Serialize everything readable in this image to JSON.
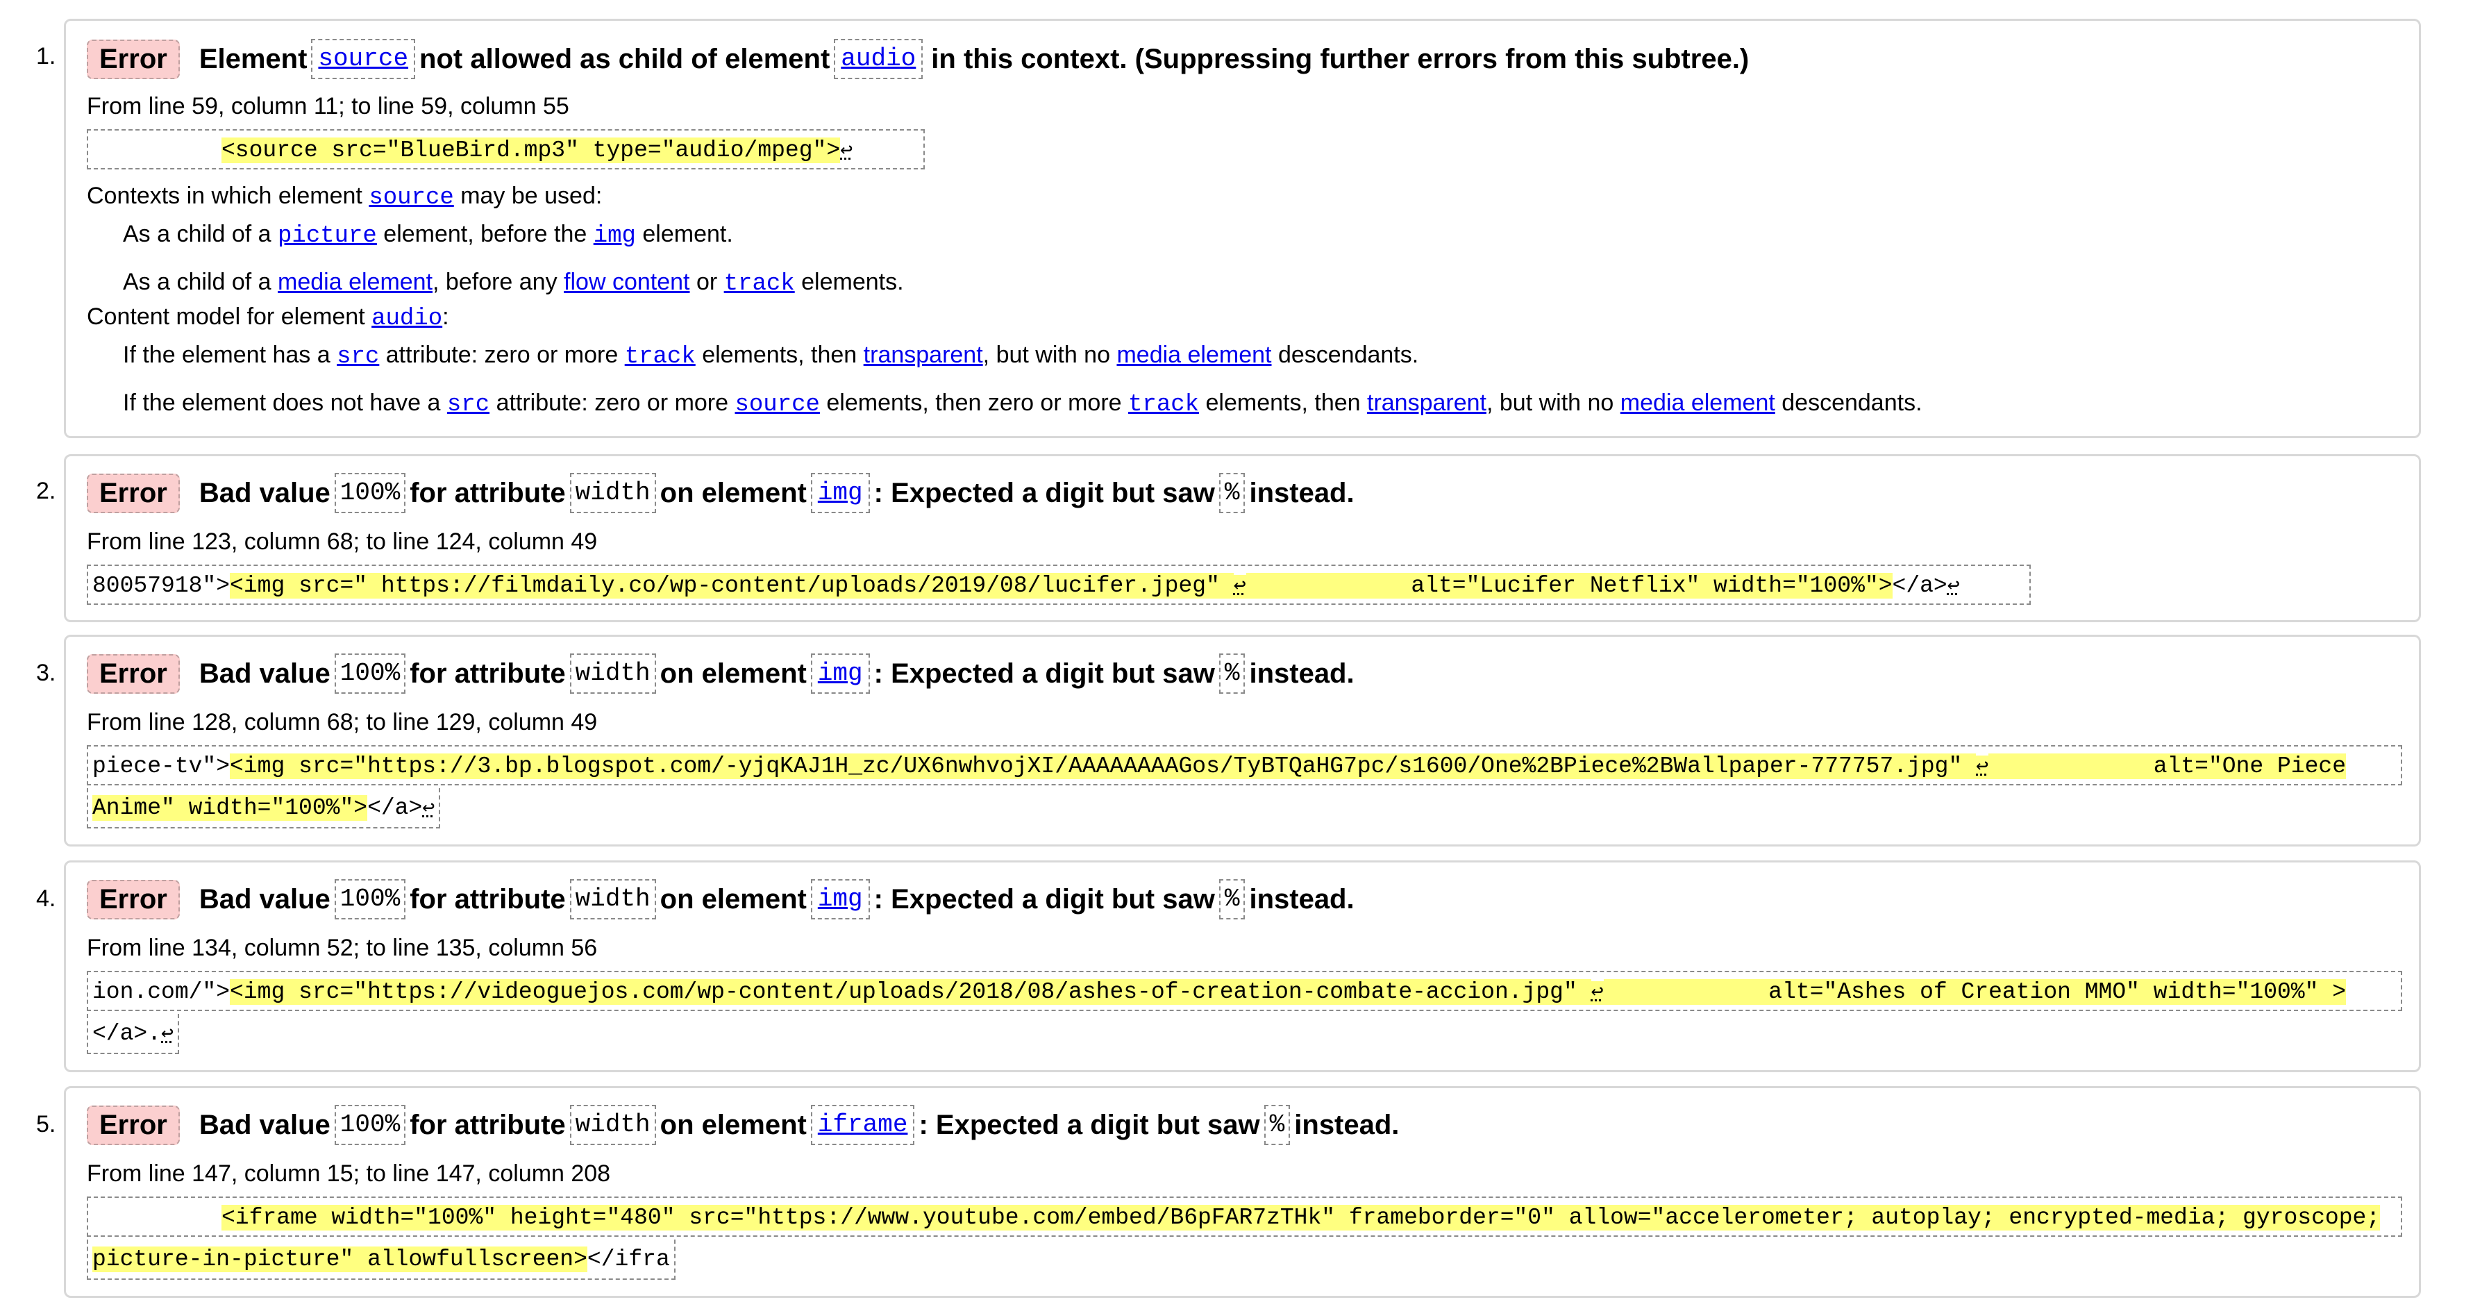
{
  "errors": [
    {
      "number": "1.",
      "badge": "Error",
      "msg_parts": [
        "Element",
        "source",
        "not allowed as child of element",
        "audio",
        "in this context. (Suppressing further errors from this subtree.)"
      ],
      "location": "From line 59, column 11; to line 59, column 55",
      "excerpt_plain": "",
      "excerpt_hl": "<source src=\"BlueBird.mp3\" type=\"audio/mpeg\">",
      "ctx_intro": "Contexts in which element",
      "ctx_elem": "source",
      "ctx_tail": "may be used:",
      "ctx1_a": "As a child of a",
      "ctx1_b": "picture",
      "ctx1_c": "element, before the",
      "ctx1_d": "img",
      "ctx1_e": "element.",
      "ctx2_a": "As a child of a",
      "ctx2_b": "media element",
      "ctx2_c": ", before any",
      "ctx2_d": "flow content",
      "ctx2_e": "or",
      "ctx2_f": "track",
      "ctx2_g": "elements.",
      "cm_intro": "Content model for element",
      "cm_elem": "audio",
      "cm_colon": ":",
      "cm1_a": "If the element has a",
      "cm1_b": "src",
      "cm1_c": "attribute: zero or more",
      "cm1_d": "track",
      "cm1_e": "elements, then",
      "cm1_f": "transparent",
      "cm1_g": ", but with no",
      "cm1_h": "media element",
      "cm1_i": "descendants.",
      "cm2_a": "If the element does not have a",
      "cm2_b": "src",
      "cm2_c": "attribute: zero or more",
      "cm2_d": "source",
      "cm2_e": "elements, then zero or more",
      "cm2_f": "track",
      "cm2_g": "elements, then",
      "cm2_h": "transparent",
      "cm2_i": ", but with no",
      "cm2_j": "media element",
      "cm2_k": "descendants."
    },
    {
      "number": "2.",
      "badge": "Error",
      "msg_parts": [
        "Bad value",
        "100%",
        "for attribute",
        "width",
        "on element",
        "img",
        ": Expected a digit but saw",
        "%",
        "instead."
      ],
      "location": "From line 123, column 68; to line 124, column 49",
      "excerpt_plain": "80057918\">",
      "excerpt_hl": "<img src=\" https://filmdaily.co/wp-content/uploads/2019/08/lucifer.jpeg\" ",
      "excerpt_hl2": "            alt=\"Lucifer Netflix\" width=\"100%\">",
      "excerpt_tail": "</a>"
    },
    {
      "number": "3.",
      "badge": "Error",
      "msg_parts": [
        "Bad value",
        "100%",
        "for attribute",
        "width",
        "on element",
        "img",
        ": Expected a digit but saw",
        "%",
        "instead."
      ],
      "location": "From line 128, column 68; to line 129, column 49",
      "excerpt_plain": "piece-tv\">",
      "excerpt_hl": "<img src=\"https://3.bp.blogspot.com/-yjqKAJ1H_zc/UX6nwhvojXI/AAAAAAAAGos/TyBTQaHG7pc/s1600/One%2BPiece%2BWallpaper-777757.jpg\" ",
      "excerpt_hl2": "            alt=\"One Piece",
      "excerpt_hl3": "Anime\" width=\"100%\">",
      "excerpt_tail": "</a>"
    },
    {
      "number": "4.",
      "badge": "Error",
      "msg_parts": [
        "Bad value",
        "100%",
        "for attribute",
        "width",
        "on element",
        "img",
        ": Expected a digit but saw",
        "%",
        "instead."
      ],
      "location": "From line 134, column 52; to line 135, column 56",
      "excerpt_plain": "ion.com/\">",
      "excerpt_hl": "<img src=\"https://videoguejos.com/wp-content/uploads/2018/08/ashes-of-creation-combate-accion.jpg\" ",
      "excerpt_hl2": "            alt=\"Ashes of Creation MMO\" width=\"100%\" >",
      "excerpt_tail": "</a>."
    },
    {
      "number": "5.",
      "badge": "Error",
      "msg_parts": [
        "Bad value",
        "100%",
        "for attribute",
        "width",
        "on element",
        "iframe",
        ": Expected a digit but saw",
        "%",
        "instead."
      ],
      "location": "From line 147, column 15; to line 147, column 208",
      "excerpt_plain": "",
      "excerpt_hl": "<iframe width=\"100%\" height=\"480\" src=\"https://www.youtube.com/embed/B6pFAR7zTHk\" frameborder=\"0\" allow=\"accelerometer; autoplay; encrypted-media; gyroscope;",
      "excerpt_hl3": "picture-in-picture\" allowfullscreen>",
      "excerpt_tail": "</ifra"
    }
  ],
  "return_glyph": "↩",
  "colors": {
    "badge_bg": "#fbcfcf",
    "highlight": "#ffff80",
    "link": "#0000ee"
  }
}
